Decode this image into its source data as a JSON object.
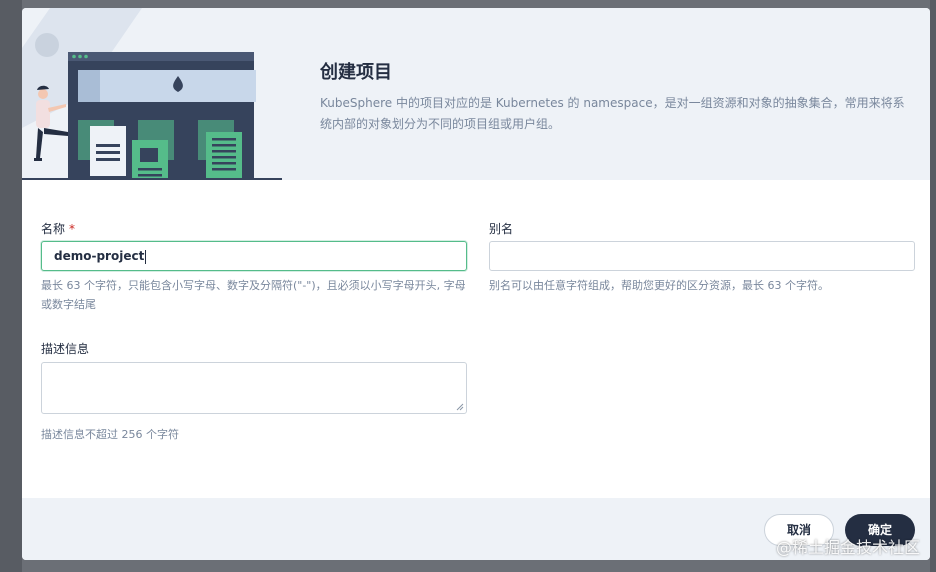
{
  "dialog": {
    "title": "创建项目",
    "description": "KubeSphere 中的项目对应的是 Kubernetes 的 namespace，是对一组资源和对象的抽象集合，常用来将系统内部的对象划分为不同的项目组或用户组。"
  },
  "form": {
    "name": {
      "label": "名称",
      "required_mark": "*",
      "value": "demo-project",
      "hint": "最长 63 个字符，只能包含小写字母、数字及分隔符(\"-\")，且必须以小写字母开头, 字母或数字结尾"
    },
    "alias": {
      "label": "别名",
      "value": "",
      "hint": "别名可以由任意字符组成，帮助您更好的区分资源，最长 63 个字符。"
    },
    "description": {
      "label": "描述信息",
      "value": "",
      "hint": "描述信息不超过 256 个字符"
    }
  },
  "footer": {
    "cancel_label": "取消",
    "ok_label": "确定"
  },
  "watermark": "@稀土掘金技术社区",
  "colors": {
    "accent_green": "#55bc8a",
    "dark": "#242e42",
    "required": "#ca2621",
    "header_bg": "#eef2f7"
  }
}
